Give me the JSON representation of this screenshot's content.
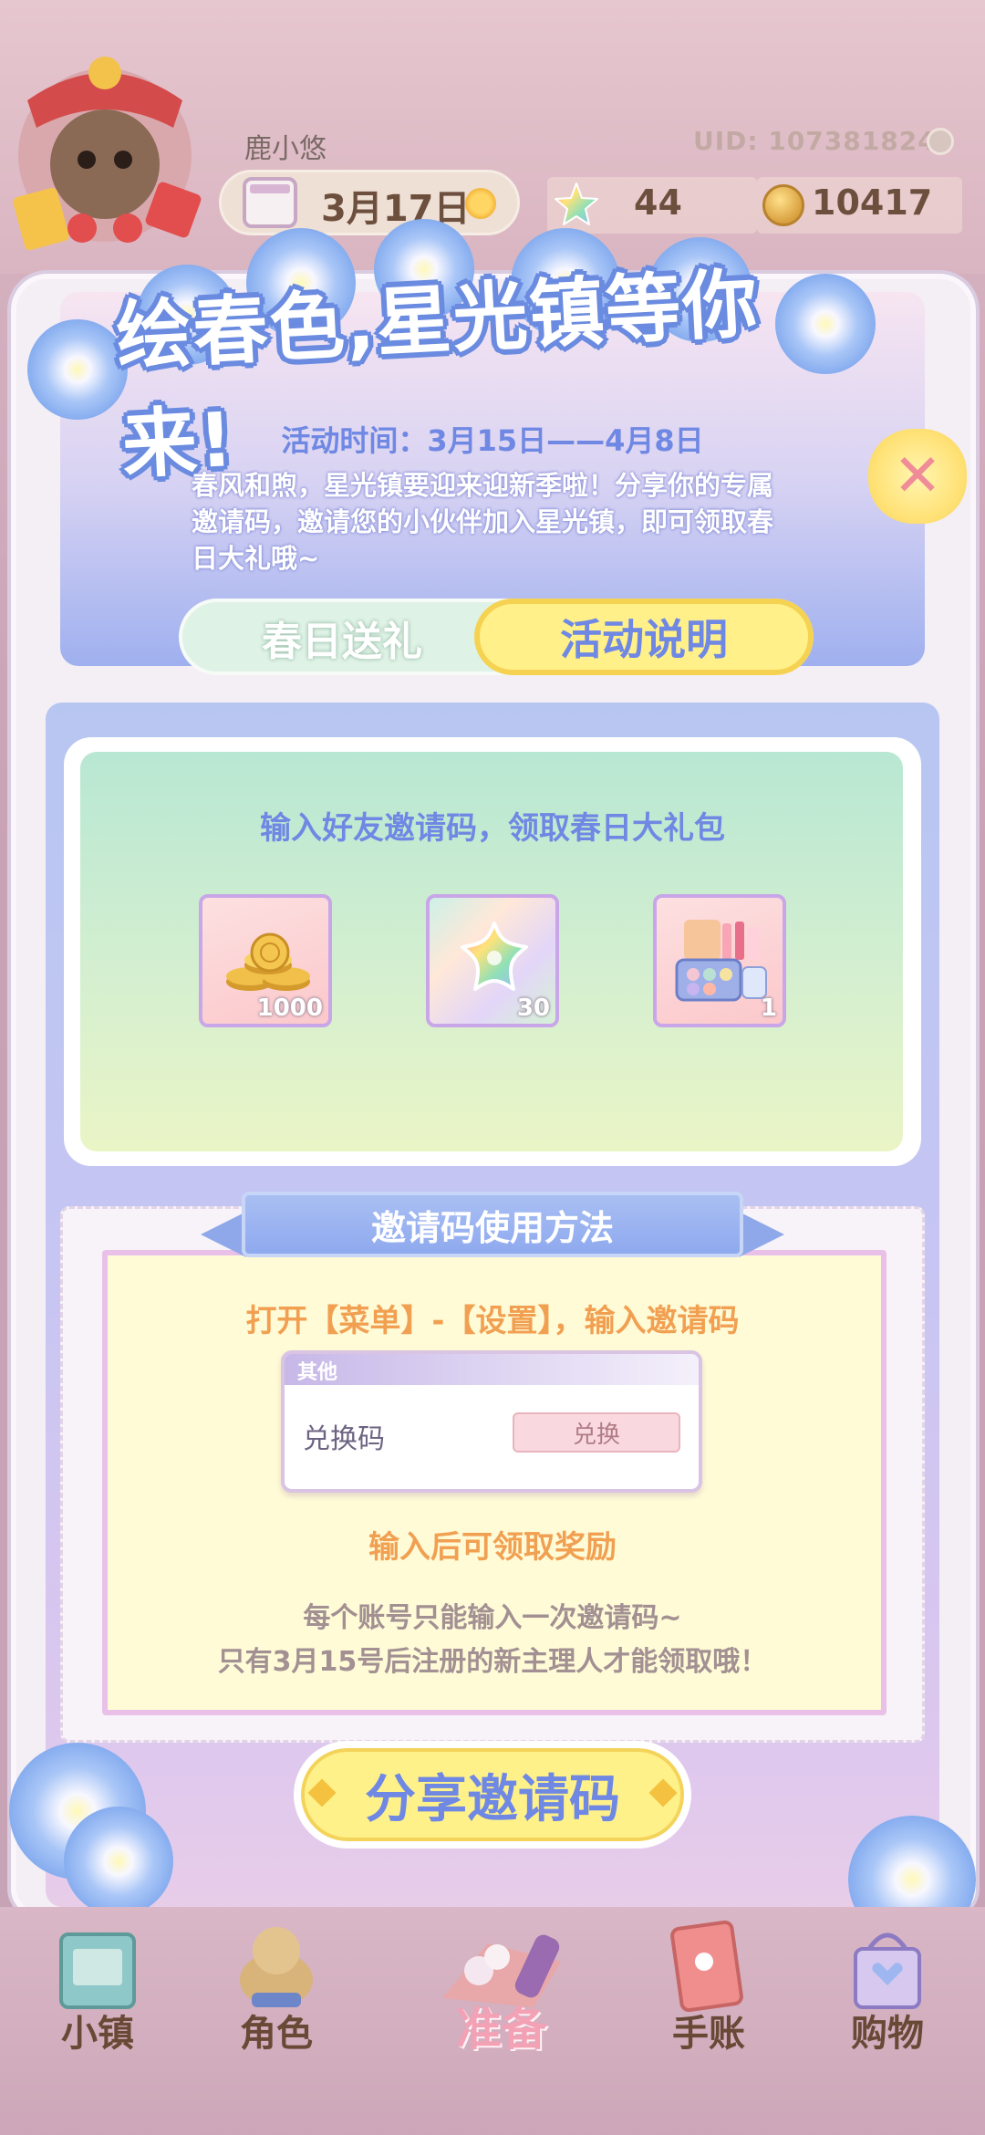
{
  "hud": {
    "player_name": "鹿小悠",
    "uid": "UID: 1073818242",
    "date": "3月17日",
    "stars": "44",
    "coins": "10417"
  },
  "popup": {
    "title": "绘春色,星光镇等你来!",
    "event_time": "活动时间：3月15日——4月8日",
    "intro": "春风和煦，星光镇要迎来迎新季啦！分享你的专属邀请码，邀请您的小伙伴加入星光镇，即可领取春日大礼哦~",
    "close_icon": "close-icon",
    "tabs": [
      {
        "label": "春日送礼",
        "active": false
      },
      {
        "label": "活动说明",
        "active": true
      }
    ],
    "gift": {
      "heading": "输入好友邀请码，领取春日大礼包",
      "rewards": [
        {
          "icon": "gold-coins-icon",
          "qty": "1000"
        },
        {
          "icon": "rainbow-star-icon",
          "qty": "30"
        },
        {
          "icon": "makeup-kit-icon",
          "qty": "1"
        }
      ]
    },
    "usage": {
      "title": "邀请码使用方法",
      "step1": "打开【菜单】-【设置】，输入邀请码",
      "mock": {
        "header": "其他",
        "label": "兑换码",
        "button": "兑换"
      },
      "step2": "输入后可领取奖励",
      "note1": "每个账号只能输入一次邀请码~",
      "note2": "只有3月15号后注册的新主理人才能领取哦！"
    },
    "share_button": "分享邀请码"
  },
  "nav": {
    "items": [
      {
        "label": "小镇",
        "icon": "town-icon"
      },
      {
        "label": "角色",
        "icon": "character-icon"
      },
      {
        "label": "准备",
        "icon": "prepare-icon"
      },
      {
        "label": "手账",
        "icon": "journal-icon"
      },
      {
        "label": "购物",
        "icon": "shopping-icon"
      }
    ]
  },
  "colors": {
    "accent_blue": "#6f88e3",
    "accent_yellow": "#fff08a",
    "orange_text": "#f1a052"
  }
}
